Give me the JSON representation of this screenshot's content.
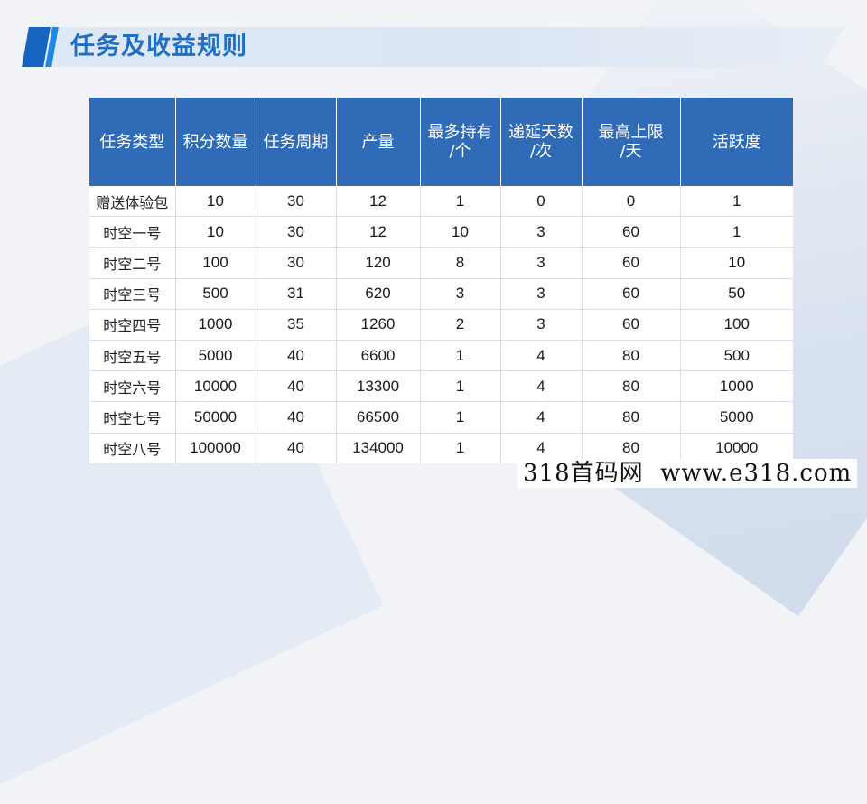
{
  "title": "任务及收益规则",
  "table": {
    "headers": [
      [
        "任务类型"
      ],
      [
        "积分数量"
      ],
      [
        "任务周期"
      ],
      [
        "产量"
      ],
      [
        "最多持有",
        "/个"
      ],
      [
        "递延天数",
        "/次"
      ],
      [
        "最高上限",
        "/天"
      ],
      [
        "活跃度"
      ]
    ],
    "rows": [
      [
        "赠送体验包",
        "10",
        "30",
        "12",
        "1",
        "0",
        "0",
        "1"
      ],
      [
        "时空一号",
        "10",
        "30",
        "12",
        "10",
        "3",
        "60",
        "1"
      ],
      [
        "时空二号",
        "100",
        "30",
        "120",
        "8",
        "3",
        "60",
        "10"
      ],
      [
        "时空三号",
        "500",
        "31",
        "620",
        "3",
        "3",
        "60",
        "50"
      ],
      [
        "时空四号",
        "1000",
        "35",
        "1260",
        "2",
        "3",
        "60",
        "100"
      ],
      [
        "时空五号",
        "5000",
        "40",
        "6600",
        "1",
        "4",
        "80",
        "500"
      ],
      [
        "时空六号",
        "10000",
        "40",
        "13300",
        "1",
        "4",
        "80",
        "1000"
      ],
      [
        "时空七号",
        "50000",
        "40",
        "66500",
        "1",
        "4",
        "80",
        "5000"
      ],
      [
        "时空八号",
        "100000",
        "40",
        "134000",
        "1",
        "4",
        "80",
        "10000"
      ]
    ]
  },
  "watermark": "318首码网  www.e318.com",
  "colors": {
    "header_bg": "#2f6bb6",
    "title_text": "#1f6fc7",
    "accent": "#1565c0"
  }
}
